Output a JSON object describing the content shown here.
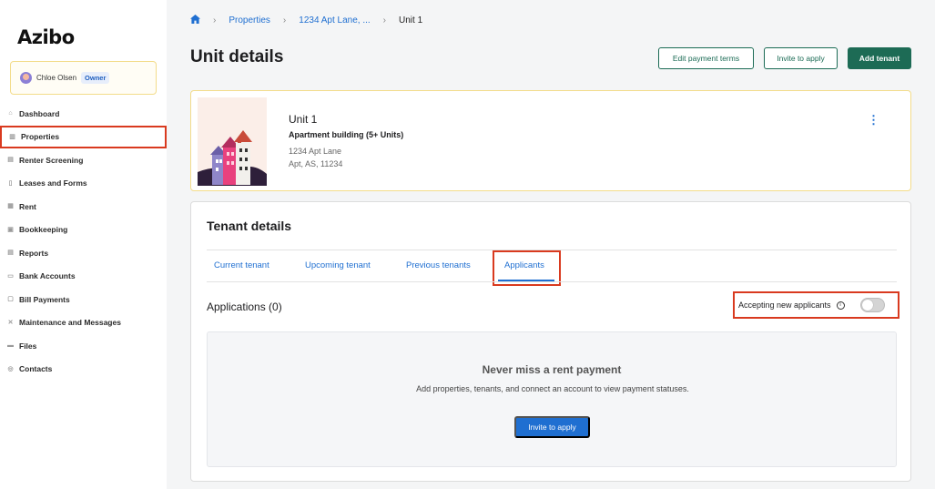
{
  "app": {
    "logo": "Azibo"
  },
  "account": {
    "name": "Chloe Olsen",
    "role": "Owner"
  },
  "sidebar": {
    "items": [
      {
        "label": "Dashboard",
        "icon": "home-icon"
      },
      {
        "label": "Properties",
        "icon": "building-icon",
        "active": true
      },
      {
        "label": "Renter Screening",
        "icon": "screening-icon"
      },
      {
        "label": "Leases and Forms",
        "icon": "document-icon"
      },
      {
        "label": "Rent",
        "icon": "rent-icon"
      },
      {
        "label": "Bookkeeping",
        "icon": "ledger-icon"
      },
      {
        "label": "Reports",
        "icon": "report-icon"
      },
      {
        "label": "Bank Accounts",
        "icon": "bank-icon"
      },
      {
        "label": "Bill Payments",
        "icon": "bill-icon"
      },
      {
        "label": "Maintenance and Messages",
        "icon": "wrench-icon"
      },
      {
        "label": "Files",
        "icon": "folder-icon"
      },
      {
        "label": "Contacts",
        "icon": "contacts-icon"
      }
    ]
  },
  "breadcrumb": {
    "items": [
      "Properties",
      "1234 Apt Lane, ...",
      "Unit 1"
    ]
  },
  "header": {
    "title": "Unit details",
    "edit_payment_terms": "Edit payment terms",
    "invite_to_apply": "Invite to apply",
    "add_tenant": "Add tenant"
  },
  "unit": {
    "name": "Unit 1",
    "type": "Apartment building (5+ Units)",
    "address_line1": "1234 Apt Lane",
    "address_line2": "Apt, AS, 11234"
  },
  "tenant_details": {
    "title": "Tenant details",
    "tabs": [
      "Current tenant",
      "Upcoming tenant",
      "Previous tenants",
      "Applicants"
    ],
    "active_tab": "Applicants",
    "applications_title": "Applications (0)",
    "accepting_label": "Accepting new applicants",
    "accepting_enabled": false,
    "empty": {
      "title": "Never miss a rent payment",
      "description": "Add properties, tenants, and connect an account to view payment statuses.",
      "button": "Invite to apply"
    }
  },
  "colors": {
    "primary_green": "#1d6b55",
    "link_blue": "#1f6fd1",
    "highlight_red": "#d93a1f",
    "card_yellow_border": "#f3dc8a"
  }
}
